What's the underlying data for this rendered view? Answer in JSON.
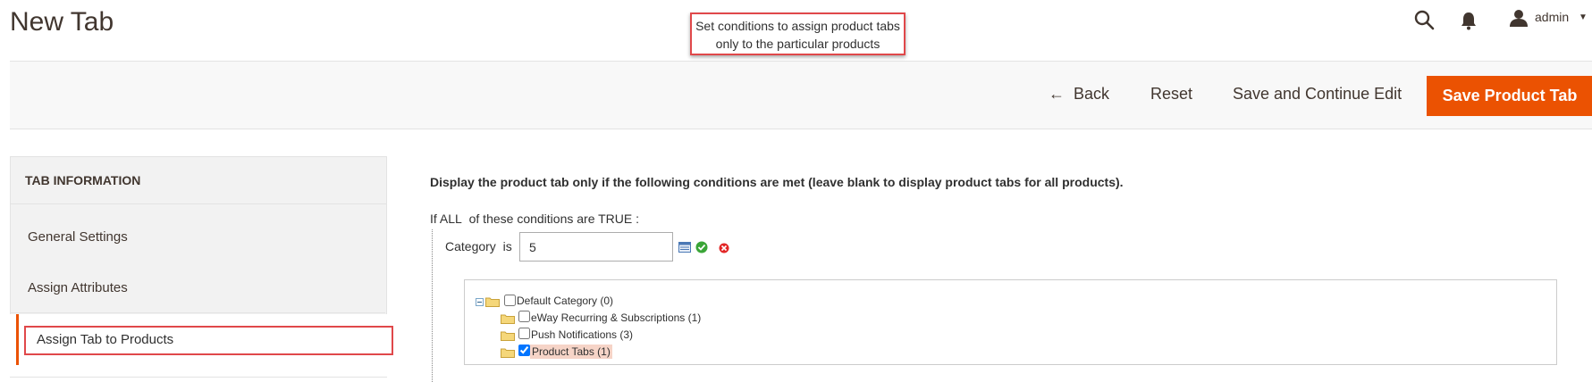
{
  "page": {
    "title": "New Tab",
    "callout": "Set conditions to assign product tabs only to the particular products"
  },
  "header": {
    "user_name": "admin",
    "icons": [
      "search-icon",
      "bell-icon",
      "user-icon",
      "caret-down-icon"
    ]
  },
  "toolbar": {
    "back_label": "Back",
    "reset_label": "Reset",
    "save_continue_label": "Save and Continue Edit",
    "save_label": "Save Product Tab"
  },
  "sidebar": {
    "title": "TAB INFORMATION",
    "items": [
      {
        "label": "General Settings",
        "active": false
      },
      {
        "label": "Assign Attributes",
        "active": false
      },
      {
        "label": "Assign Tab to Products",
        "active": true
      }
    ]
  },
  "conditions": {
    "description": "Display the product tab only if the following conditions are met (leave blank to display product tabs for all products).",
    "if_prefix": "If",
    "aggregator": "ALL",
    "middle": "of these conditions are",
    "value": "TRUE",
    "suffix": ":",
    "rule": {
      "attribute": "Category",
      "operator": "is",
      "value": "5"
    }
  },
  "category_tree": {
    "root": {
      "label": "Default Category (0)",
      "checked": false
    },
    "children": [
      {
        "label": "eWay Recurring & Subscriptions (1)",
        "checked": false
      },
      {
        "label": "Push Notifications (3)",
        "checked": false
      },
      {
        "label": "Product Tabs (1)",
        "checked": true
      }
    ]
  },
  "colors": {
    "accent": "#eb5202",
    "callout_border": "#e0484a",
    "highlight": "#f6d4c7"
  }
}
